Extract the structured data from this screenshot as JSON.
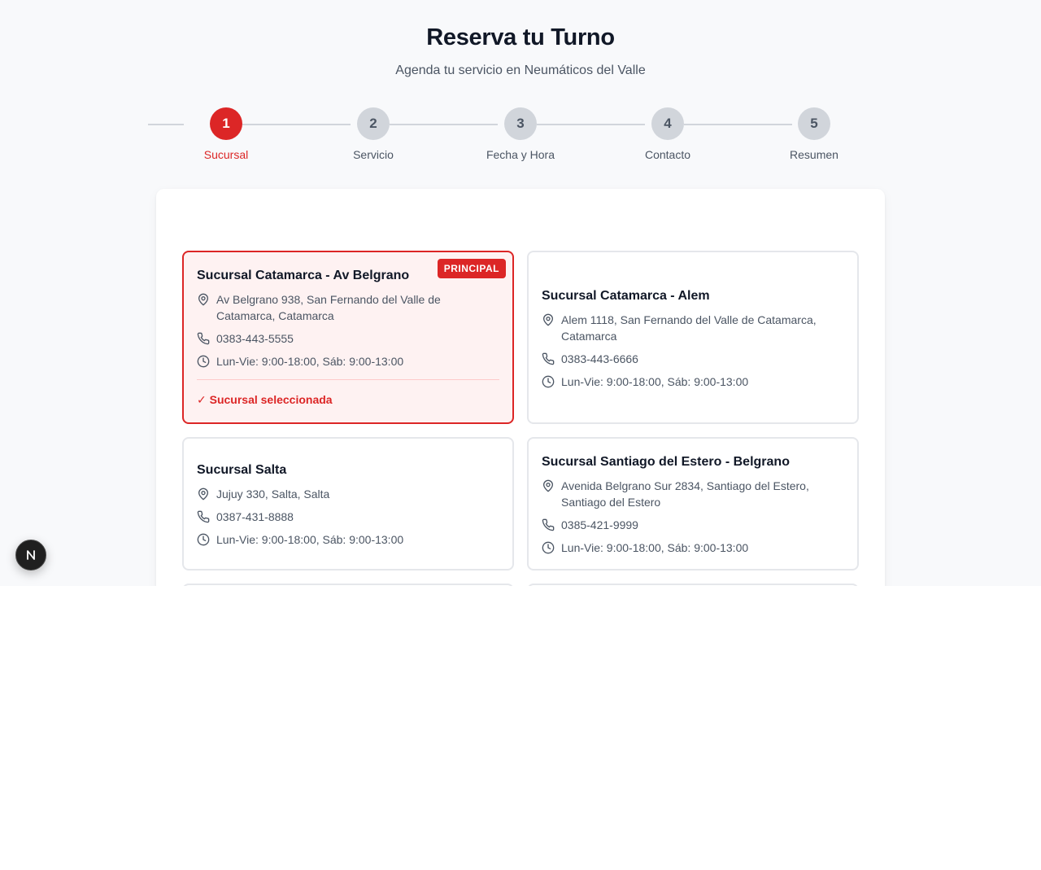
{
  "header": {
    "title": "Reserva tu Turno",
    "subtitle": "Agenda tu servicio en Neumáticos del Valle"
  },
  "stepper": {
    "active_step": 1,
    "steps": [
      {
        "number": "1",
        "label": "Sucursal"
      },
      {
        "number": "2",
        "label": "Servicio"
      },
      {
        "number": "3",
        "label": "Fecha y Hora"
      },
      {
        "number": "4",
        "label": "Contacto"
      },
      {
        "number": "5",
        "label": "Resumen"
      }
    ]
  },
  "branches": [
    {
      "name": "Sucursal Catamarca - Av Belgrano",
      "address": "Av Belgrano 938, San Fernando del Valle de Catamarca, Catamarca",
      "phone": "0383-443-5555",
      "hours": "Lun-Vie: 9:00-18:00, Sáb: 9:00-13:00",
      "badge": "PRINCIPAL",
      "selected": true,
      "selected_label": "✓ Sucursal seleccionada"
    },
    {
      "name": "Sucursal Catamarca - Alem",
      "address": "Alem 1118, San Fernando del Valle de Catamarca, Catamarca",
      "phone": "0383-443-6666",
      "hours": "Lun-Vie: 9:00-18:00, Sáb: 9:00-13:00"
    },
    {
      "name": "Sucursal Salta",
      "address": "Jujuy 330, Salta, Salta",
      "phone": "0387-431-8888",
      "hours": "Lun-Vie: 9:00-18:00, Sáb: 9:00-13:00"
    },
    {
      "name": "Sucursal Santiago del Estero - Belgrano",
      "address": "Avenida Belgrano Sur 2834, Santiago del Estero, Santiago del Estero",
      "phone": "0385-421-9999",
      "hours": "Lun-Vie: 9:00-18:00, Sáb: 9:00-13:00"
    }
  ],
  "icons": {
    "address": "map-pin-icon",
    "phone": "phone-icon",
    "hours": "clock-icon",
    "floating_button": "nextjs-logo-icon"
  },
  "colors": {
    "accent": "#dc2626",
    "accent_bg": "#fef2f2",
    "step_inactive": "#d1d5db",
    "page_bg": "#f8f9fb"
  }
}
